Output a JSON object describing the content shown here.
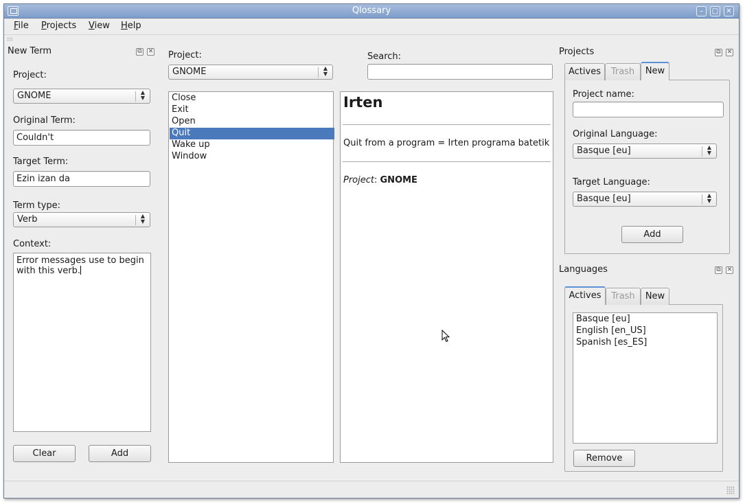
{
  "window": {
    "title": "Qlossary"
  },
  "menu": {
    "file": "File",
    "projects": "Projects",
    "view": "View",
    "help": "Help"
  },
  "new_term": {
    "dock_title": "New Term",
    "project_label": "Project:",
    "project_value": "GNOME",
    "original_label": "Original Term:",
    "original_value": "Couldn't",
    "target_label": "Target Term:",
    "target_value": "Ezin izan da",
    "type_label": "Term type:",
    "type_value": "Verb",
    "context_label": "Context:",
    "context_value": "Error messages use to begin with this verb.",
    "clear_button": "Clear",
    "add_button": "Add"
  },
  "browser": {
    "project_label": "Project:",
    "project_value": "GNOME",
    "search_label": "Search:",
    "search_value": "",
    "terms": [
      "Close",
      "Exit",
      "Open",
      "Quit",
      "Wake up",
      "Window"
    ],
    "selected_term": "Quit"
  },
  "detail": {
    "heading": "Irten",
    "definition": "Quit from a program = Irten programa batetik",
    "project_key": "Project",
    "project_value": "GNOME"
  },
  "projects_dock": {
    "title": "Projects",
    "tabs": [
      "Actives",
      "Trash",
      "New"
    ],
    "active_tab": "New",
    "name_label": "Project name:",
    "name_value": "",
    "orig_lang_label": "Original Language:",
    "orig_lang_value": "Basque [eu]",
    "target_lang_label": "Target Language:",
    "target_lang_value": "Basque [eu]",
    "add_button": "Add"
  },
  "languages_dock": {
    "title": "Languages",
    "tabs": [
      "Actives",
      "Trash",
      "New"
    ],
    "active_tab": "Actives",
    "items": [
      "Basque [eu]",
      "English [en_US]",
      "Spanish [es_ES]"
    ],
    "remove_button": "Remove"
  },
  "colors": {
    "selection": "#4a79bc",
    "titlebar": "#8fabd3",
    "window_bg": "#ededed"
  }
}
